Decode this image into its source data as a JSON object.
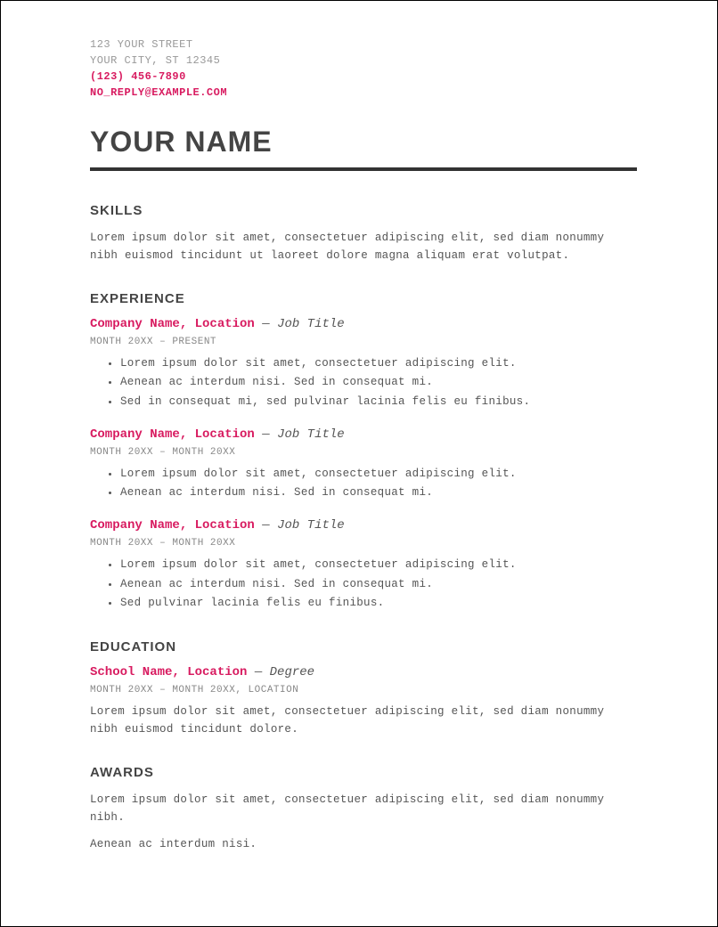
{
  "contact": {
    "street": "123 YOUR STREET",
    "city_line": "YOUR CITY, ST 12345",
    "phone": "(123) 456-7890",
    "email": "NO_REPLY@EXAMPLE.COM"
  },
  "name": "YOUR NAME",
  "sections": {
    "skills": {
      "heading": "SKILLS",
      "body": "Lorem ipsum dolor sit amet, consectetuer adipiscing elit, sed diam nonummy nibh euismod tincidunt ut laoreet dolore magna aliquam erat volutpat."
    },
    "experience": {
      "heading": "EXPERIENCE",
      "entries": [
        {
          "org": "Company Name, Location",
          "title": "Job Title",
          "dates": "MONTH 20XX – PRESENT",
          "bullets": [
            "Lorem ipsum dolor sit amet, consectetuer adipiscing elit.",
            "Aenean ac interdum nisi. Sed in consequat mi.",
            "Sed in consequat mi, sed pulvinar lacinia felis eu finibus."
          ]
        },
        {
          "org": "Company Name, Location",
          "title": "Job Title",
          "dates": "MONTH 20XX – MONTH 20XX",
          "bullets": [
            "Lorem ipsum dolor sit amet, consectetuer adipiscing elit.",
            "Aenean ac interdum nisi. Sed in consequat mi."
          ]
        },
        {
          "org": "Company Name, Location",
          "title": "Job Title",
          "dates": "MONTH 20XX – MONTH 20XX",
          "bullets": [
            "Lorem ipsum dolor sit amet, consectetuer adipiscing elit.",
            "Aenean ac interdum nisi. Sed in consequat mi.",
            "Sed pulvinar lacinia felis eu finibus."
          ]
        }
      ]
    },
    "education": {
      "heading": "EDUCATION",
      "entries": [
        {
          "org": "School Name, Location",
          "title": "Degree",
          "dates": "MONTH 20XX – MONTH 20XX, LOCATION",
          "body": "Lorem ipsum dolor sit amet, consectetuer adipiscing elit, sed diam nonummy nibh euismod tincidunt dolore."
        }
      ]
    },
    "awards": {
      "heading": "AWARDS",
      "paragraphs": [
        "Lorem ipsum dolor sit amet, consectetuer adipiscing elit, sed diam nonummy nibh.",
        "Aenean ac interdum nisi."
      ]
    }
  }
}
